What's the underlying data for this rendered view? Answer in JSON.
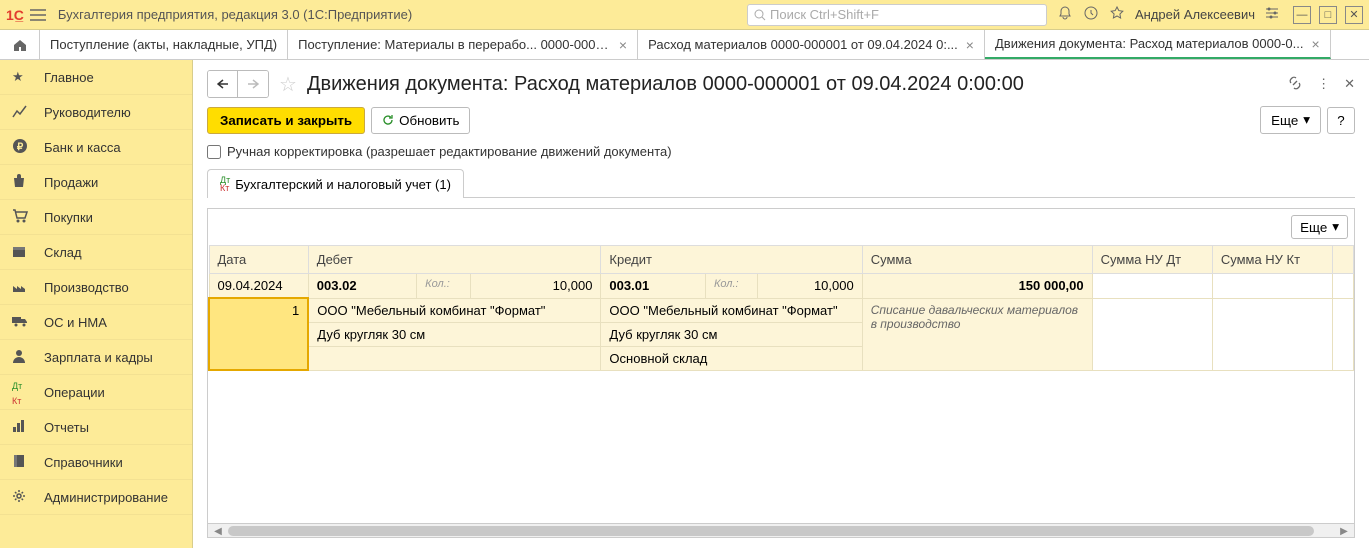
{
  "app_title": "Бухгалтерия предприятия, редакция 3.0  (1С:Предприятие)",
  "search_placeholder": "Поиск Ctrl+Shift+F",
  "user": "Андрей Алексеевич",
  "tabs": [
    {
      "label": "Поступление (акты, накладные, УПД)",
      "closable": false,
      "active": false
    },
    {
      "label": "Поступление: Материалы в перерабо... 0000-000015",
      "closable": true,
      "active": false
    },
    {
      "label": "Расход материалов 0000-000001 от 09.04.2024 0:...",
      "closable": true,
      "active": false
    },
    {
      "label": "Движения документа: Расход материалов 0000-0...",
      "closable": true,
      "active": true
    }
  ],
  "sidebar": [
    {
      "name": "main",
      "label": "Главное"
    },
    {
      "name": "manager",
      "label": "Руководителю"
    },
    {
      "name": "bank",
      "label": "Банк и касса"
    },
    {
      "name": "sales",
      "label": "Продажи"
    },
    {
      "name": "purchases",
      "label": "Покупки"
    },
    {
      "name": "warehouse",
      "label": "Склад"
    },
    {
      "name": "production",
      "label": "Производство"
    },
    {
      "name": "assets",
      "label": "ОС и НМА"
    },
    {
      "name": "hr",
      "label": "Зарплата и кадры"
    },
    {
      "name": "operations",
      "label": "Операции"
    },
    {
      "name": "reports",
      "label": "Отчеты"
    },
    {
      "name": "catalogs",
      "label": "Справочники"
    },
    {
      "name": "admin",
      "label": "Администрирование"
    }
  ],
  "page": {
    "title": "Движения документа: Расход материалов 0000-000001 от 09.04.2024 0:00:00",
    "save_close": "Записать и закрыть",
    "refresh": "Обновить",
    "more": "Еще",
    "help": "?",
    "manual_check": "Ручная корректировка (разрешает редактирование движений документа)",
    "sub_tab": "Бухгалтерский и налоговый учет (1)"
  },
  "table": {
    "headers": {
      "date": "Дата",
      "debit": "Дебет",
      "credit": "Кредит",
      "sum": "Сумма",
      "sum_nu_dt": "Сумма НУ Дт",
      "sum_nu_kt": "Сумма НУ Кт"
    },
    "row": {
      "date": "09.04.2024",
      "n": "1",
      "debit_acct": "003.02",
      "debit_kol_label": "Кол.:",
      "debit_qty": "10,000",
      "debit_org": "ООО \"Мебельный комбинат \"Формат\"",
      "debit_item": "Дуб кругляк 30 см",
      "credit_acct": "003.01",
      "credit_kol_label": "Кол.:",
      "credit_qty": "10,000",
      "credit_org": "ООО \"Мебельный комбинат \"Формат\"",
      "credit_item": "Дуб кругляк 30 см",
      "credit_wh": "Основной склад",
      "sum": "150 000,00",
      "comment": "Списание давальческих материалов в производство"
    }
  }
}
